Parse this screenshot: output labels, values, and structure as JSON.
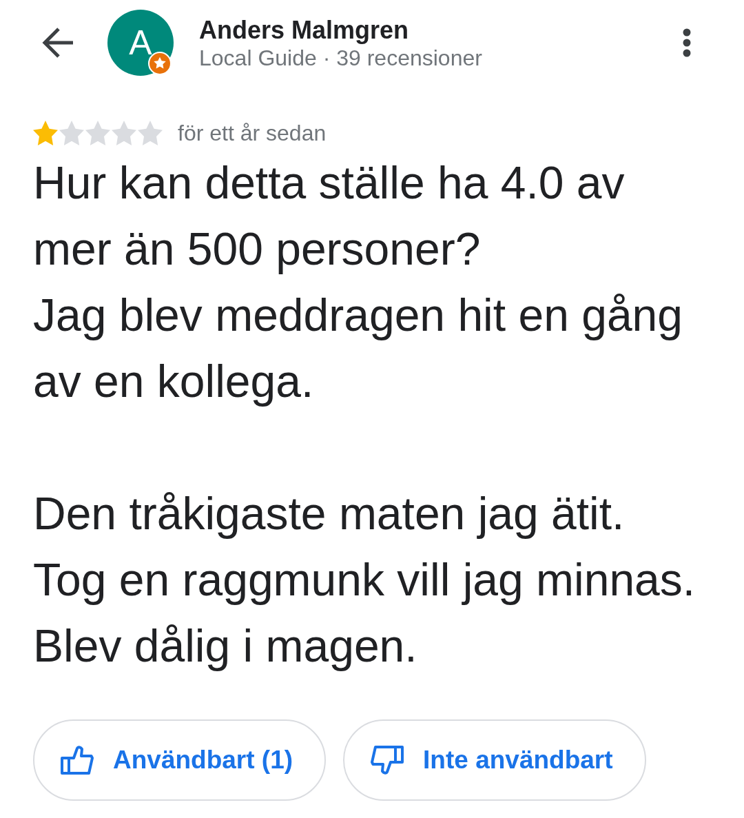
{
  "header": {
    "avatar_initial": "A",
    "name": "Anders Malmgren",
    "subtitle": "Local Guide · 39 recensioner"
  },
  "review": {
    "stars": 1,
    "time": "för ett år sedan",
    "text": "Hur kan detta ställe ha 4.0 av mer än 500 personer?\nJag blev meddragen hit en gång av en kollega.\n\nDen tråkigaste maten jag ätit.\nTog en raggmunk vill jag minnas.\nBlev dålig i magen."
  },
  "actions": [
    {
      "kind": "helpful",
      "label": "Användbart (1)"
    },
    {
      "kind": "not_helpful",
      "label": "Inte användbart"
    }
  ]
}
